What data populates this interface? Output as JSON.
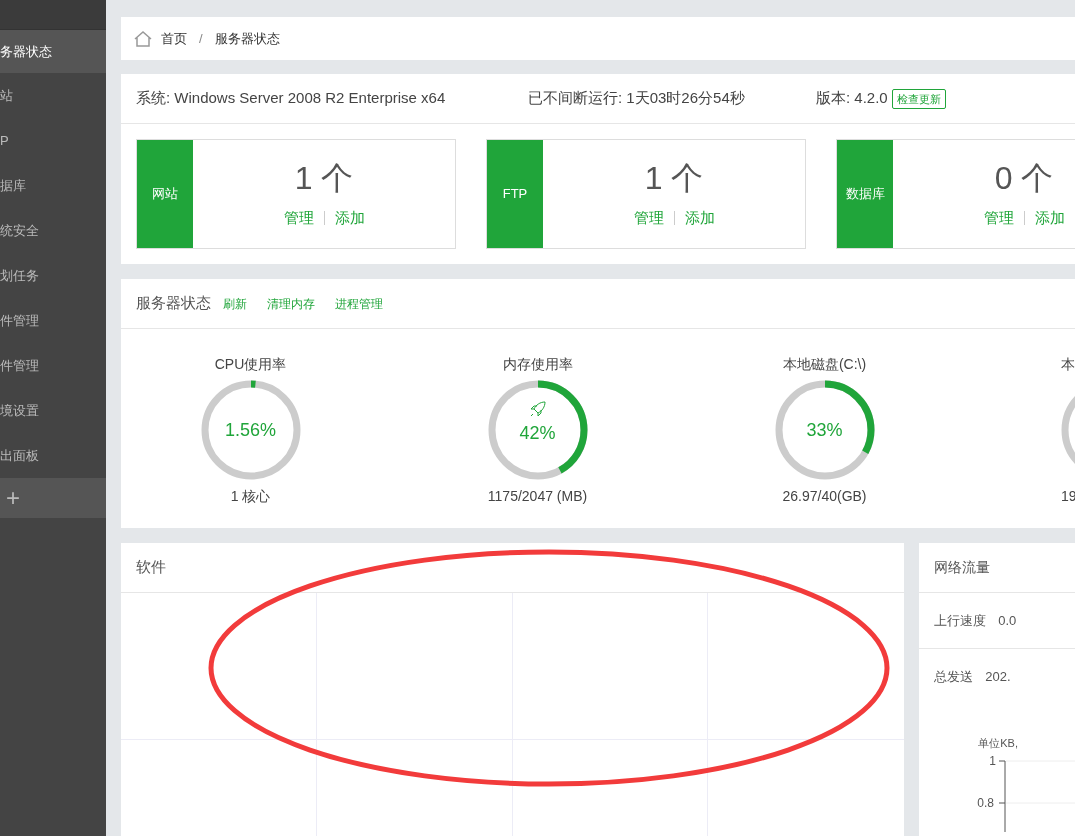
{
  "sidebar": {
    "items": [
      {
        "label": "务器状态",
        "selected": true
      },
      {
        "label": "站",
        "selected": false
      },
      {
        "label": "P",
        "selected": false
      },
      {
        "label": "据库",
        "selected": false
      },
      {
        "label": "统安全",
        "selected": false
      },
      {
        "label": "划任务",
        "selected": false
      },
      {
        "label": "件管理",
        "selected": false
      },
      {
        "label": "件管理",
        "selected": false
      },
      {
        "label": "境设置",
        "selected": false
      },
      {
        "label": "出面板",
        "selected": false
      }
    ],
    "add_button": "+"
  },
  "breadcrumb": [
    "首页",
    "/",
    "服务器状态"
  ],
  "info": {
    "system": "系统: Windows Server 2008 R2 Enterprise x64",
    "uptime": "已不间断运行: 1天03时26分54秒",
    "version": "版本: 4.2.0",
    "update_button": "检查更新"
  },
  "stat_cards": [
    {
      "label": "网站",
      "count": "1 个",
      "manage": "管理",
      "add": "添加"
    },
    {
      "label": "FTP",
      "count": "1 个",
      "manage": "管理",
      "add": "添加"
    },
    {
      "label": "数据库",
      "count": "0 个",
      "manage": "管理",
      "add": "添加"
    }
  ],
  "status": {
    "title": "服务器状态",
    "actions": [
      "刷新",
      "清理内存",
      "进程管理"
    ],
    "gauges": [
      {
        "title": "CPU使用率",
        "value": "1.56%",
        "detail": "1 核心",
        "level": 0.0156,
        "show_icon": false
      },
      {
        "title": "内存使用率",
        "value": "42%",
        "detail": "1175/2047 (MB)",
        "level": 0.42,
        "show_icon": true
      },
      {
        "title": "本地磁盘(C:\\)",
        "value": "33%",
        "detail": "26.97/40(GB)",
        "level": 0.33,
        "show_icon": false
      }
    ],
    "partial_gauge": {
      "title": "本",
      "detail": "19"
    }
  },
  "software": {
    "title": "软件"
  },
  "network": {
    "title": "网络流量",
    "upload_label": "上行速度",
    "upload_value": "0.0",
    "total_label": "总发送",
    "total_value": "202.",
    "unit": "单位KB,",
    "y_ticks": [
      "1",
      "0.8"
    ]
  }
}
